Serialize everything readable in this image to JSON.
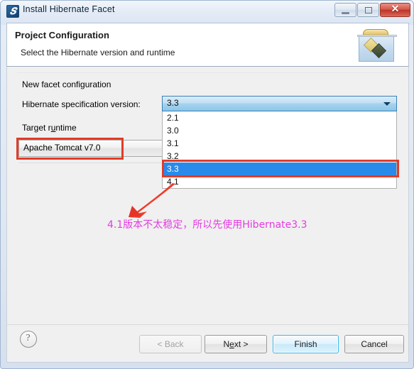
{
  "window": {
    "title": "Install Hibernate Facet",
    "app_icon": "hibernate-icon",
    "controls": {
      "minimize": "minimize-icon",
      "maximize": "maximize-icon",
      "close": "✕"
    }
  },
  "banner": {
    "title": "Project Configuration",
    "subtitle": "Select the Hibernate version and runtime",
    "icon": "hibernate-banner-icon"
  },
  "form": {
    "group_label": "New facet configuration",
    "spec_version_label": "Hibernate specification version:",
    "spec_version_value": "3.3",
    "spec_version_options": [
      "2.1",
      "3.0",
      "3.1",
      "3.2",
      "3.3",
      "4.1"
    ],
    "spec_version_selected_index": 4,
    "target_runtime_label_prefix": "Target r",
    "target_runtime_label_mnemonic": "u",
    "target_runtime_label_suffix": "ntime",
    "target_runtime_value": "Apache Tomcat v7.0"
  },
  "annotations": {
    "note_text": "4.1版本不太稳定，所以先使用Hibernate3.3",
    "note_color": "#e43ce0",
    "box_color": "#e23c28",
    "arrow": "red-arrow-icon"
  },
  "buttons": {
    "help": "help-icon",
    "back": "< Back",
    "next_prefix": "N",
    "next_mnemonic": "e",
    "next_suffix": "xt >",
    "finish": "Finish",
    "cancel": "Cancel"
  }
}
